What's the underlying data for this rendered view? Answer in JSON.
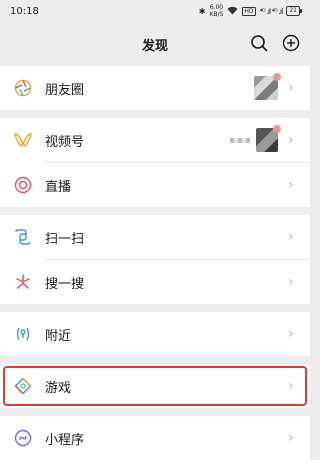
{
  "status": {
    "time": "10:18",
    "net_speed": "6.00",
    "net_unit": "KB/S",
    "hd": "HD",
    "signal": "⁴ᴳ .ıl ⁴ᴳ .ıl",
    "battery": "21"
  },
  "nav": {
    "title": "发现"
  },
  "menu": {
    "moments": "朋友圈",
    "channels": "视频号",
    "live": "直播",
    "scan": "扫一扫",
    "shake": "搜一搜",
    "nearby": "附近",
    "games": "游戏",
    "mini_programs": "小程序"
  },
  "colors": {
    "highlight": "#e53b3b",
    "page_bg": "#ededed"
  },
  "icons": [
    "wifi",
    "search",
    "plus-circle",
    "camera-aperture",
    "butterfly",
    "live",
    "scan",
    "shake-search",
    "nearby",
    "game-diamond",
    "mini-program"
  ]
}
